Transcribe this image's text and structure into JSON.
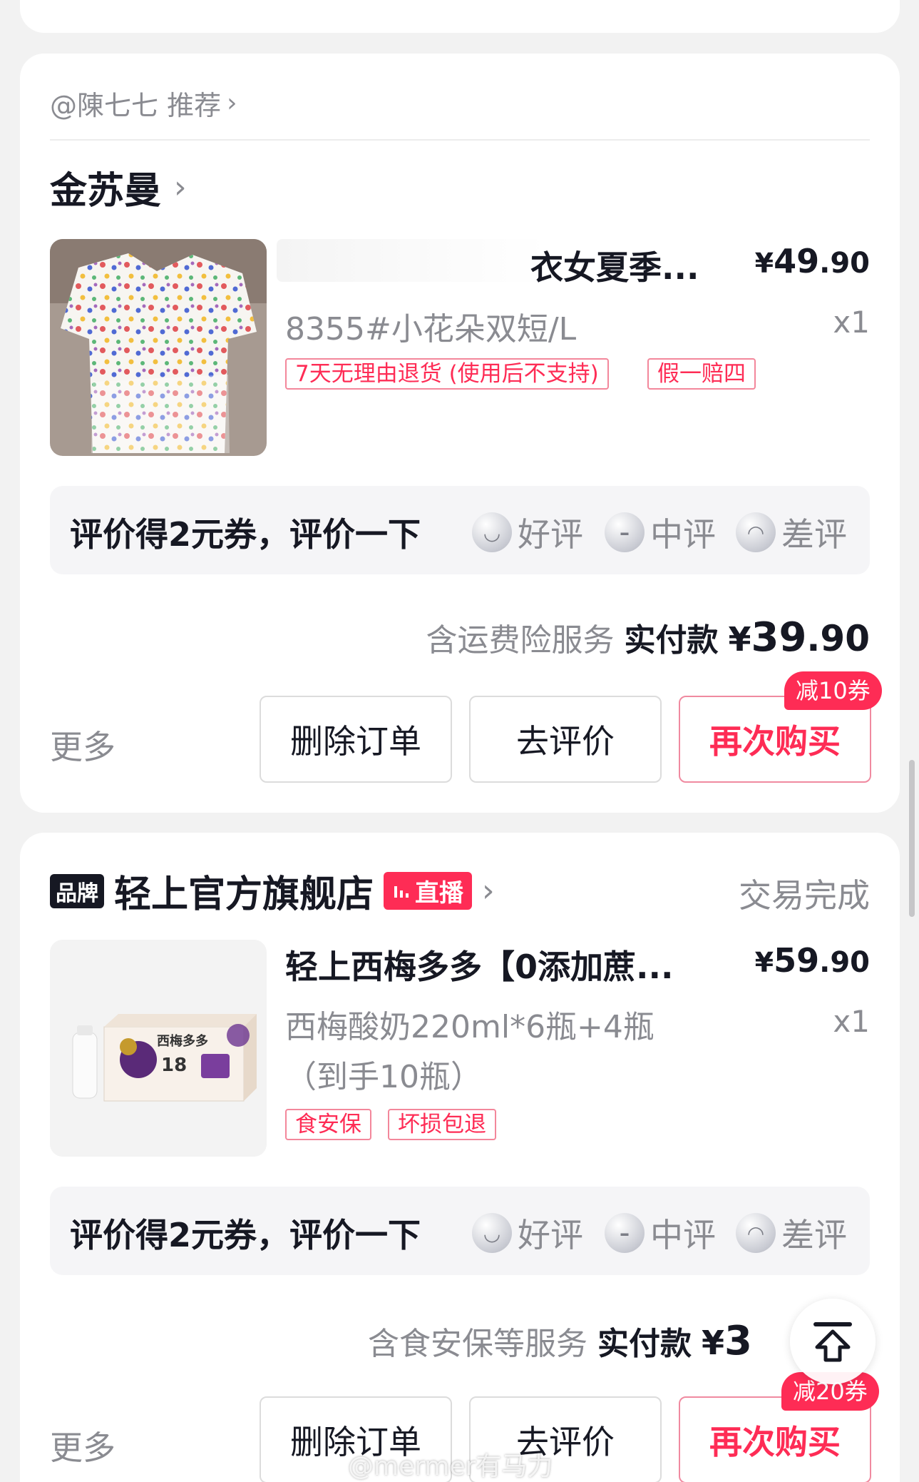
{
  "order1": {
    "recommend": "@陳七七 推荐",
    "shop_name": "金苏曼",
    "product": {
      "title": "衣女夏季...",
      "price_yen": "¥",
      "price_int": "49",
      "price_dec": ".90",
      "spec": "8355#小花朵双短/L",
      "qty": "x1",
      "tags": [
        "7天无理由退货 (使用后不支持)",
        "假一赔四"
      ]
    },
    "review": {
      "text": "评价得2元券，评价一下",
      "good": "好评",
      "neutral": "中评",
      "bad": "差评"
    },
    "total": {
      "service": "含运费险服务",
      "paid_label": "实付款",
      "yen": "¥",
      "int": "39",
      "dec": ".90"
    },
    "actions": {
      "more": "更多",
      "delete": "删除订单",
      "review": "去评价",
      "rebuy": "再次购买",
      "coupon": "减10券"
    }
  },
  "order2": {
    "brand_badge": "品牌",
    "shop_name": "轻上官方旗舰店",
    "live_badge": "直播",
    "status": "交易完成",
    "product": {
      "title": "轻上西梅多多【0添加蔗...",
      "price_yen": "¥",
      "price_int": "59",
      "price_dec": ".90",
      "spec_line1": "西梅酸奶220ml*6瓶+4瓶",
      "spec_line2": "（到手10瓶）",
      "qty": "x1",
      "tags": [
        "食安保",
        "坏损包退"
      ],
      "package_label": "西梅多多",
      "package_number": "18"
    },
    "review": {
      "text": "评价得2元券，评价一下",
      "good": "好评",
      "neutral": "中评",
      "bad": "差评"
    },
    "total": {
      "service": "含食安保等服务",
      "paid_label": "实付款",
      "yen": "¥",
      "int": "3"
    },
    "actions": {
      "more": "更多",
      "delete": "删除订单",
      "review": "去评价",
      "rebuy": "再次购买",
      "coupon": "减20券"
    }
  },
  "watermark": "@mermer有马力",
  "colors": {
    "accent": "#fe2c55",
    "background": "#f2f2f2",
    "text_primary": "#161823",
    "text_secondary": "#8a8b91"
  }
}
